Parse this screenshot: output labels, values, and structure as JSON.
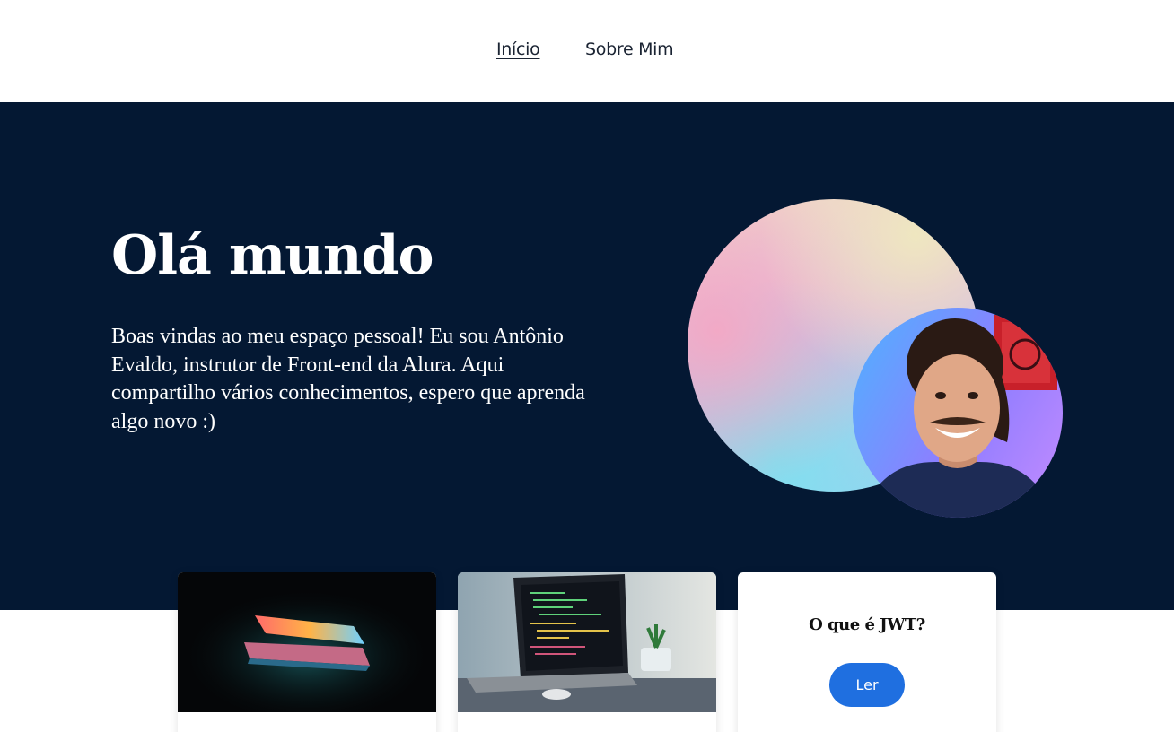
{
  "nav": {
    "items": [
      {
        "label": "Início",
        "active": true
      },
      {
        "label": "Sobre Mim",
        "active": false
      }
    ]
  },
  "hero": {
    "title": "Olá mundo",
    "text": "Boas vindas ao meu espaço pessoal! Eu sou Antônio Evaldo, instrutor de Front-end da Alura. Aqui compartilho vários conhecimentos, espero que aprenda algo novo :)",
    "background_color": "#041833",
    "avatar_icon": "profile-photo"
  },
  "cards": [
    {
      "image": "laptop-glow-photo",
      "title": ""
    },
    {
      "image": "laptop-code-photo",
      "title": ""
    },
    {
      "title": "O que é JWT?",
      "button_label": "Ler",
      "button_color": "#1f6fe0"
    }
  ]
}
